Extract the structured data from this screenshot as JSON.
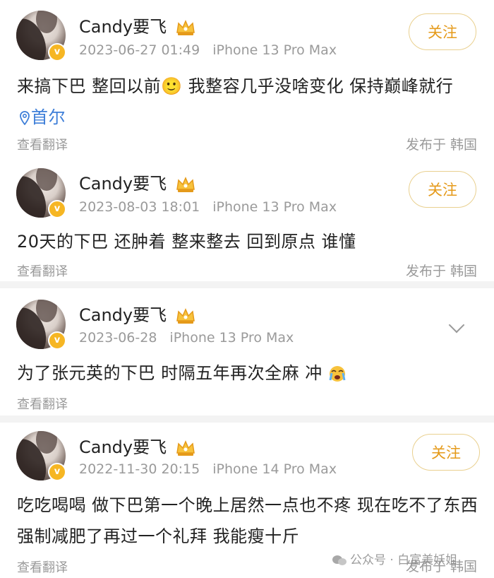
{
  "posts": [
    {
      "username": "Candy要飞",
      "date": "2023-06-27 01:49",
      "device": "iPhone 13 Pro Max",
      "follow_label": "关注",
      "content": "来搞下巴 整回以前🙂 我整容几乎没啥变化 保持巅峰就行",
      "location": "首尔",
      "translate_label": "查看翻译",
      "publish_label": "发布于 韩国"
    },
    {
      "username": "Candy要飞",
      "date": "2023-08-03 18:01",
      "device": "iPhone 13 Pro Max",
      "follow_label": "关注",
      "content": "20天的下巴 还肿着 整来整去 回到原点 谁懂",
      "translate_label": "查看翻译",
      "publish_label": "发布于 韩国"
    },
    {
      "username": "Candy要飞",
      "date": "2023-06-28",
      "device": "iPhone 13 Pro Max",
      "content": "为了张元英的下巴 时隔五年再次全麻 冲",
      "translate_label": "查看翻译"
    },
    {
      "username": "Candy要飞",
      "date": "2022-11-30 20:15",
      "device": "iPhone 14 Pro Max",
      "follow_label": "关注",
      "content": "吃吃喝喝 做下巴第一个晚上居然一点也不疼 现在吃不了东西 强制减肥了再过一个礼拜 我能瘦十斤",
      "translate_label": "查看翻译",
      "publish_label": "发布于 韩国"
    }
  ],
  "watermark": "公众号 · 白富美妖姐",
  "colors": {
    "accent": "#e59a1a",
    "location": "#3d7ed8",
    "muted": "#9a9a9a"
  }
}
